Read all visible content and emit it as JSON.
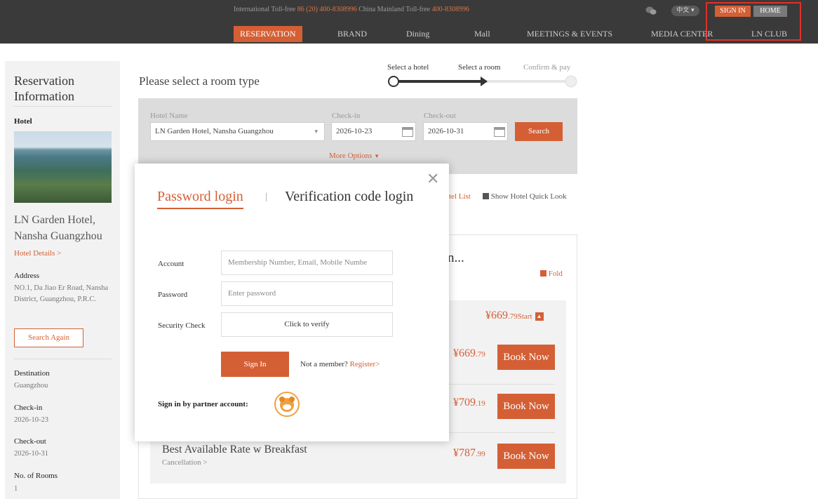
{
  "header": {
    "toll_intl_label": "International Toll-free",
    "toll_intl_number": "86 (20) 400-8308996",
    "toll_cn_label": "China Mainland Toll-free",
    "toll_cn_number": "400-8308996",
    "lang": "中文",
    "sign_in": "SIGN IN",
    "home": "HOME",
    "nav": [
      "RESERVATION",
      "BRAND",
      "Dining",
      "Mall",
      "MEETINGS & EVENTS",
      "MEDIA CENTER",
      "LN CLUB"
    ]
  },
  "sidebar": {
    "heading": "Reservation Information",
    "hotel_label": "Hotel",
    "hotel_name": "LN Garden Hotel, Nansha Guangzhou",
    "hotel_details": "Hotel Details >",
    "address_label": "Address",
    "address": "NO.1, Da Jiao Er Road, Nansha District, Guangzhou, P.R.C.",
    "search_again": "Search Again",
    "destination_label": "Destination",
    "destination": "Guangzhou",
    "checkin_label": "Check-in",
    "checkin": "2026-10-23",
    "checkout_label": "Check-out",
    "checkout": "2026-10-31",
    "rooms_label": "No. of Rooms",
    "rooms": "1"
  },
  "main": {
    "title": "Please select a room type",
    "steps": [
      "Select a hotel",
      "Select a room",
      "Confirm & pay"
    ],
    "search": {
      "hotel_label": "Hotel Name",
      "hotel_value": "LN Garden Hotel, Nansha Guangzhou",
      "checkin_label": "Check-in",
      "checkin_value": "2026-10-23",
      "checkout_label": "Check-out",
      "checkout_value": "2026-10-31",
      "search_button": "Search",
      "more_options": "More Options"
    },
    "hotel_list": "tel List",
    "quick_look": "Show Hotel Quick Look",
    "result_title_partial": "n...",
    "fold": "Fold",
    "start_price": "¥669",
    "start_price_dec": ".79",
    "start_suffix": "Start",
    "rates": [
      {
        "price": "¥669",
        "dec": ".79",
        "book": "Book Now"
      },
      {
        "price": "¥709",
        "dec": ".19",
        "book": "Book Now"
      },
      {
        "name": "Best Available Rate w Breakfast",
        "cancel": "Cancellation >",
        "price": "¥787",
        "dec": ".99",
        "book": "Book Now"
      }
    ]
  },
  "modal": {
    "tab_password": "Password login",
    "tab_sep": "|",
    "tab_verification": "Verification code login",
    "account_label": "Account",
    "account_placeholder": "Membership Number, Email, Mobile Numbe",
    "password_label": "Password",
    "password_placeholder": "Enter password",
    "security_label": "Security Check",
    "verify_text": "Click to verify",
    "sign_in": "Sign In",
    "not_member": "Not a member?",
    "register": "Register>",
    "partner_label": "Sign in by partner account:"
  },
  "colors": {
    "accent": "#d45f35",
    "topbar": "#3a3a3a",
    "highlight_box": "#e0302b"
  }
}
